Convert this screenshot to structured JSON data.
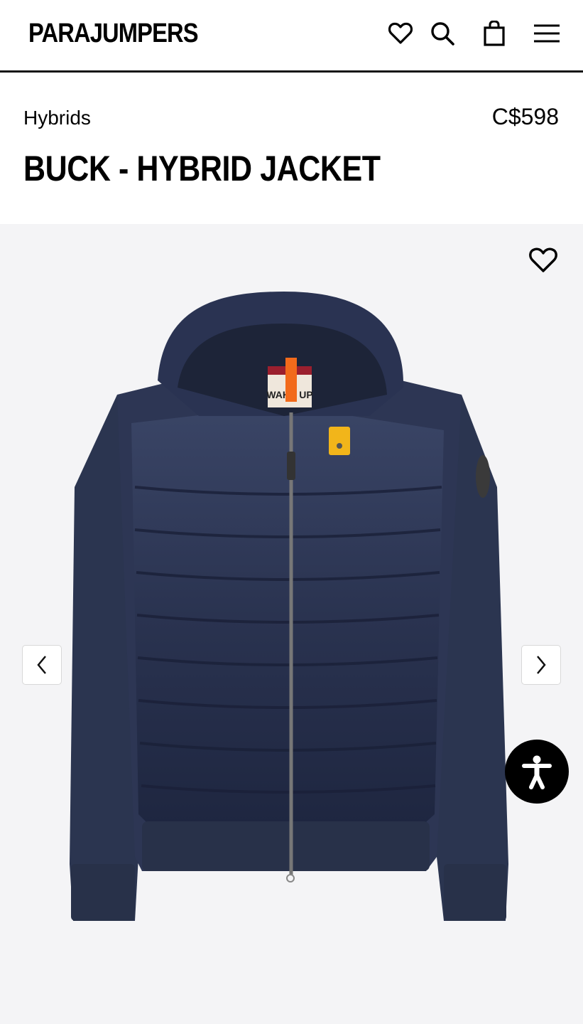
{
  "header": {
    "logo": "PARAJUMPERS",
    "icons": [
      "heart-icon",
      "search-icon",
      "shopping-bag-icon",
      "hamburger-menu-icon"
    ]
  },
  "product": {
    "category": "Hybrids",
    "price": "C$598",
    "title": "BUCK - HYBRID JACKET"
  },
  "gallery": {
    "image": "navy hybrid jacket with hood",
    "label_text": "WAKE UP",
    "controls": [
      "heart-icon",
      "chevron-left-icon",
      "chevron-right-icon",
      "accessibility-icon"
    ]
  },
  "colors": {
    "jacket": "#2b3550",
    "accent_orange": "#f26a1b",
    "accent_yellow": "#f2b51a",
    "background": "#f4f4f6"
  }
}
